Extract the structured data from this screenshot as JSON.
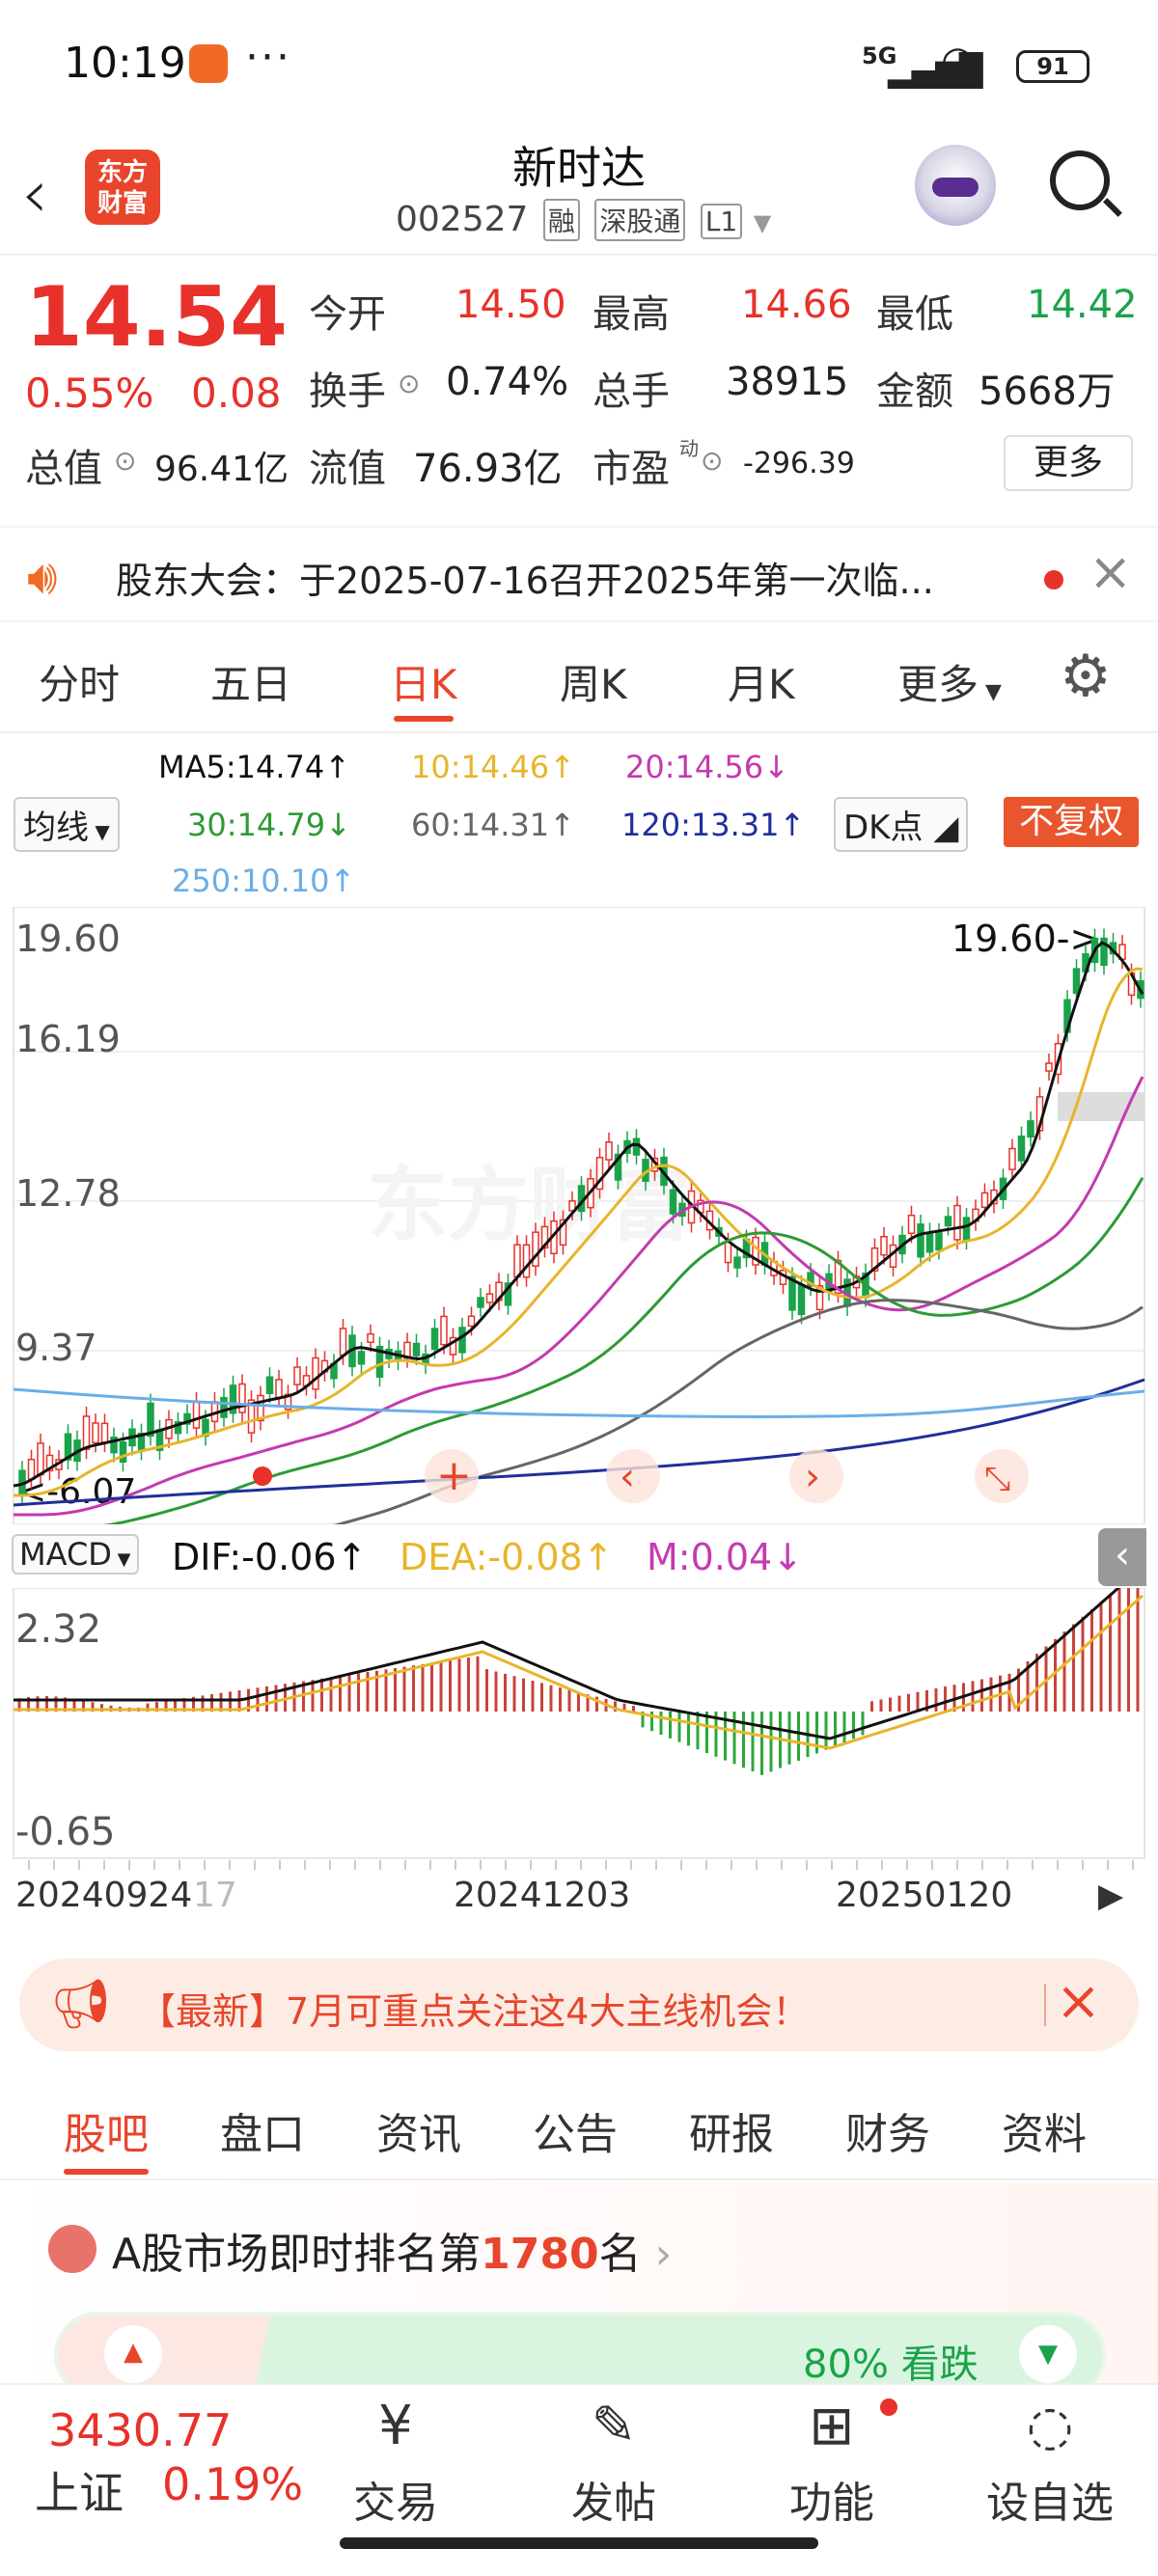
{
  "status": {
    "time": "10:19",
    "signal": "5G",
    "battery": "91"
  },
  "header": {
    "title": "新时达",
    "code": "002527",
    "tags": [
      "融",
      "深股通",
      "L1"
    ],
    "logo_line1": "东方",
    "logo_line2": "财富"
  },
  "quote": {
    "price": "14.54",
    "pct": "0.55%",
    "chg": "0.08",
    "open_label": "今开",
    "open": "14.50",
    "high_label": "最高",
    "high": "14.66",
    "low_label": "最低",
    "low": "14.42",
    "turnover_label": "换手",
    "turnover": "0.74%",
    "volume_label": "总手",
    "volume": "38915",
    "amount_label": "金额",
    "amount": "5668万",
    "mktcap_label": "总值",
    "mktcap": "96.41亿",
    "float_label": "流值",
    "float": "76.93亿",
    "pe_label": "市盈",
    "pe_sup": "动",
    "pe": "-296.39",
    "more": "更多"
  },
  "notice": {
    "text": "股东大会：于2025-07-16召开2025年第一次临..."
  },
  "ktabs": [
    "分时",
    "五日",
    "日K",
    "周K",
    "月K",
    "更多"
  ],
  "ma": {
    "select": "均线",
    "ma5": "MA5:14.74",
    "ma10": "10:14.46",
    "ma20": "20:14.56",
    "ma30": "30:14.79",
    "ma60": "60:14.31",
    "ma120": "120:13.31",
    "ma250": "250:10.10",
    "dk": "DK点",
    "fq": "不复权"
  },
  "chart_data": [
    {
      "type": "candlestick",
      "title": "",
      "y_ticks": [
        "19.60",
        "16.19",
        "12.78",
        "9.37"
      ],
      "ylim": [
        6.07,
        19.6
      ],
      "annotations": [
        "19.60->",
        "<-6.07"
      ],
      "watermark": "东方财富",
      "series_colors": {
        "ma5": "#111111",
        "ma10": "#e8b52a",
        "ma20": "#c43ab0",
        "ma30": "#2e9a35",
        "ma60": "#666666",
        "ma120": "#1f2f9a",
        "ma250": "#6aaee8"
      }
    },
    {
      "type": "macd",
      "select": "MACD",
      "dif": "DIF:-0.06",
      "dea": "DEA:-0.08",
      "m": "M:0.04",
      "y_ticks": [
        "2.32",
        "-0.65"
      ],
      "x_ticks": [
        "20240924",
        "17",
        "20241203",
        "20250120"
      ]
    }
  ],
  "banner": {
    "text": "【最新】7月可重点关注这4大主线机会！"
  },
  "subtabs": [
    "股吧",
    "盘口",
    "资讯",
    "公告",
    "研报",
    "财务",
    "资料"
  ],
  "rank": {
    "prefix": "A股市场即时排名第",
    "num": "1780",
    "suffix": "名",
    "bear": "80% 看跌"
  },
  "bottom": {
    "index_value": "3430.77",
    "index_name": "上证",
    "index_pct": "0.19%",
    "items": [
      {
        "icon": "trade-icon",
        "label": "交易"
      },
      {
        "icon": "post-icon",
        "label": "发帖"
      },
      {
        "icon": "grid-icon",
        "label": "功能"
      },
      {
        "icon": "chat-icon",
        "label": "设自选"
      }
    ]
  }
}
